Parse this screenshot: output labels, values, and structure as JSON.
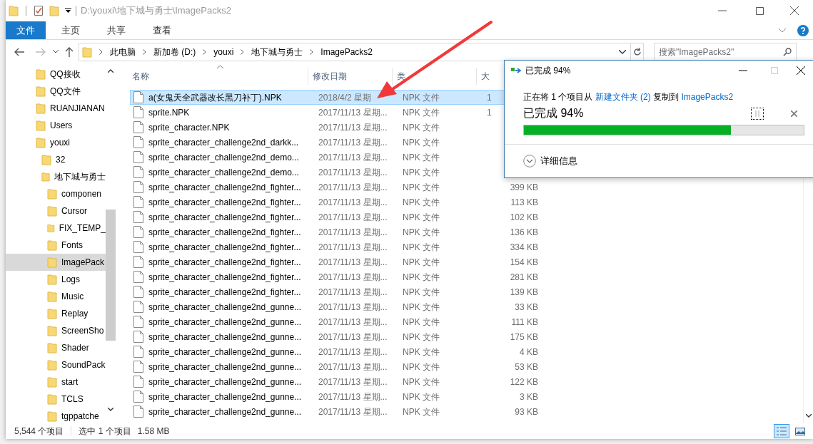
{
  "title_bar": {
    "path": "D:\\youxi\\地下城与勇士\\ImagePacks2"
  },
  "ribbon_tabs": [
    {
      "label": "文件",
      "selected": true
    },
    {
      "label": "主页",
      "selected": false
    },
    {
      "label": "共享",
      "selected": false
    },
    {
      "label": "查看",
      "selected": false
    }
  ],
  "address_bar": {
    "breadcrumbs": [
      "此电脑",
      "新加卷 (D:)",
      "youxi",
      "地下城与勇士",
      "ImagePacks2"
    ]
  },
  "search": {
    "placeholder": "搜索\"ImagePacks2\""
  },
  "sidebar": {
    "items": [
      {
        "label": "QQ接收",
        "selected": false
      },
      {
        "label": "QQ文件",
        "selected": false
      },
      {
        "label": "RUANJIANAN",
        "selected": false
      },
      {
        "label": "Users",
        "selected": false
      },
      {
        "label": "youxi",
        "selected": false,
        "children": [
          {
            "label": "32",
            "selected": false
          },
          {
            "label": "地下城与勇士",
            "selected": false,
            "children": [
              {
                "label": "componen",
                "selected": false
              },
              {
                "label": "Cursor",
                "selected": false
              },
              {
                "label": "FIX_TEMP_",
                "selected": false
              },
              {
                "label": "Fonts",
                "selected": false
              },
              {
                "label": "ImagePack",
                "selected": true
              },
              {
                "label": "Logs",
                "selected": false
              },
              {
                "label": "Music",
                "selected": false
              },
              {
                "label": "Replay",
                "selected": false
              },
              {
                "label": "ScreenSho",
                "selected": false
              },
              {
                "label": "Shader",
                "selected": false
              },
              {
                "label": "SoundPack",
                "selected": false
              },
              {
                "label": "start",
                "selected": false
              },
              {
                "label": "TCLS",
                "selected": false
              },
              {
                "label": "tgppatche",
                "selected": false
              }
            ]
          }
        ]
      }
    ]
  },
  "file_list": {
    "columns": [
      "名称",
      "修改日期",
      "类",
      "大"
    ],
    "rows": [
      {
        "name": "a(女鬼天全武器改长黑刀补丁).NPK",
        "modified": "2018/4/2 星期",
        "type": "NPK 文件",
        "size": "1",
        "selected": true
      },
      {
        "name": "sprite.NPK",
        "modified": "2017/11/13 星期...",
        "type": "NPK 文件",
        "size": "1",
        "selected": false
      },
      {
        "name": "sprite_character.NPK",
        "modified": "2017/11/13 星期...",
        "type": "NPK 文件",
        "selected": false
      },
      {
        "name": "sprite_character_challenge2nd_darkk...",
        "modified": "2017/11/13 星期...",
        "type": "NPK 文件",
        "selected": false
      },
      {
        "name": "sprite_character_challenge2nd_demo...",
        "modified": "2017/11/13 星期...",
        "type": "NPK 文件",
        "selected": false
      },
      {
        "name": "sprite_character_challenge2nd_demo...",
        "modified": "2017/11/13 星期...",
        "type": "NPK 文件",
        "selected": false
      },
      {
        "name": "sprite_character_challenge2nd_fighter...",
        "modified": "2017/11/13 星期...",
        "type": "NPK 文件",
        "size": "399 KB",
        "selected": false
      },
      {
        "name": "sprite_character_challenge2nd_fighter...",
        "modified": "2017/11/13 星期...",
        "type": "NPK 文件",
        "size": "113 KB",
        "selected": false
      },
      {
        "name": "sprite_character_challenge2nd_fighter...",
        "modified": "2017/11/13 星期...",
        "type": "NPK 文件",
        "size": "102 KB",
        "selected": false
      },
      {
        "name": "sprite_character_challenge2nd_fighter...",
        "modified": "2017/11/13 星期...",
        "type": "NPK 文件",
        "size": "136 KB",
        "selected": false
      },
      {
        "name": "sprite_character_challenge2nd_fighter...",
        "modified": "2017/11/13 星期...",
        "type": "NPK 文件",
        "size": "334 KB",
        "selected": false
      },
      {
        "name": "sprite_character_challenge2nd_fighter...",
        "modified": "2017/11/13 星期...",
        "type": "NPK 文件",
        "size": "154 KB",
        "selected": false
      },
      {
        "name": "sprite_character_challenge2nd_fighter...",
        "modified": "2017/11/13 星期...",
        "type": "NPK 文件",
        "size": "281 KB",
        "selected": false
      },
      {
        "name": "sprite_character_challenge2nd_fighter...",
        "modified": "2017/11/13 星期...",
        "type": "NPK 文件",
        "size": "139 KB",
        "selected": false
      },
      {
        "name": "sprite_character_challenge2nd_gunne...",
        "modified": "2017/11/13 星期...",
        "type": "NPK 文件",
        "size": "33 KB",
        "selected": false
      },
      {
        "name": "sprite_character_challenge2nd_gunne...",
        "modified": "2017/11/13 星期...",
        "type": "NPK 文件",
        "size": "111 KB",
        "selected": false
      },
      {
        "name": "sprite_character_challenge2nd_gunne...",
        "modified": "2017/11/13 星期...",
        "type": "NPK 文件",
        "size": "175 KB",
        "selected": false
      },
      {
        "name": "sprite_character_challenge2nd_gunne...",
        "modified": "2017/11/13 星期...",
        "type": "NPK 文件",
        "size": "4 KB",
        "selected": false
      },
      {
        "name": "sprite_character_challenge2nd_gunne...",
        "modified": "2017/11/13 星期...",
        "type": "NPK 文件",
        "size": "53 KB",
        "selected": false
      },
      {
        "name": "sprite_character_challenge2nd_gunne...",
        "modified": "2017/11/13 星期...",
        "type": "NPK 文件",
        "size": "122 KB",
        "selected": false
      },
      {
        "name": "sprite_character_challenge2nd_gunne...",
        "modified": "2017/11/13 星期...",
        "type": "NPK 文件",
        "size": "3 KB",
        "selected": false
      },
      {
        "name": "sprite_character_challenge2nd_gunne...",
        "modified": "2017/11/13 星期...",
        "type": "NPK 文件",
        "size": "93 KB",
        "selected": false
      }
    ]
  },
  "status_bar": {
    "item_count": "5,544 个项目",
    "selection": "选中 1 个项目",
    "selection_size": "1.58 MB"
  },
  "copy_dialog": {
    "title": "已完成 94%",
    "message": [
      {
        "kind": "text",
        "text": "正在将 1 个项目从"
      },
      {
        "kind": "link",
        "text": "新建文件夹 (2)"
      },
      {
        "kind": "text",
        "text": "复制到"
      },
      {
        "kind": "link",
        "text": "ImagePacks2"
      }
    ],
    "status": "已完成 94%",
    "progress": {
      "level": 0.74
    },
    "details": "详细信息"
  }
}
